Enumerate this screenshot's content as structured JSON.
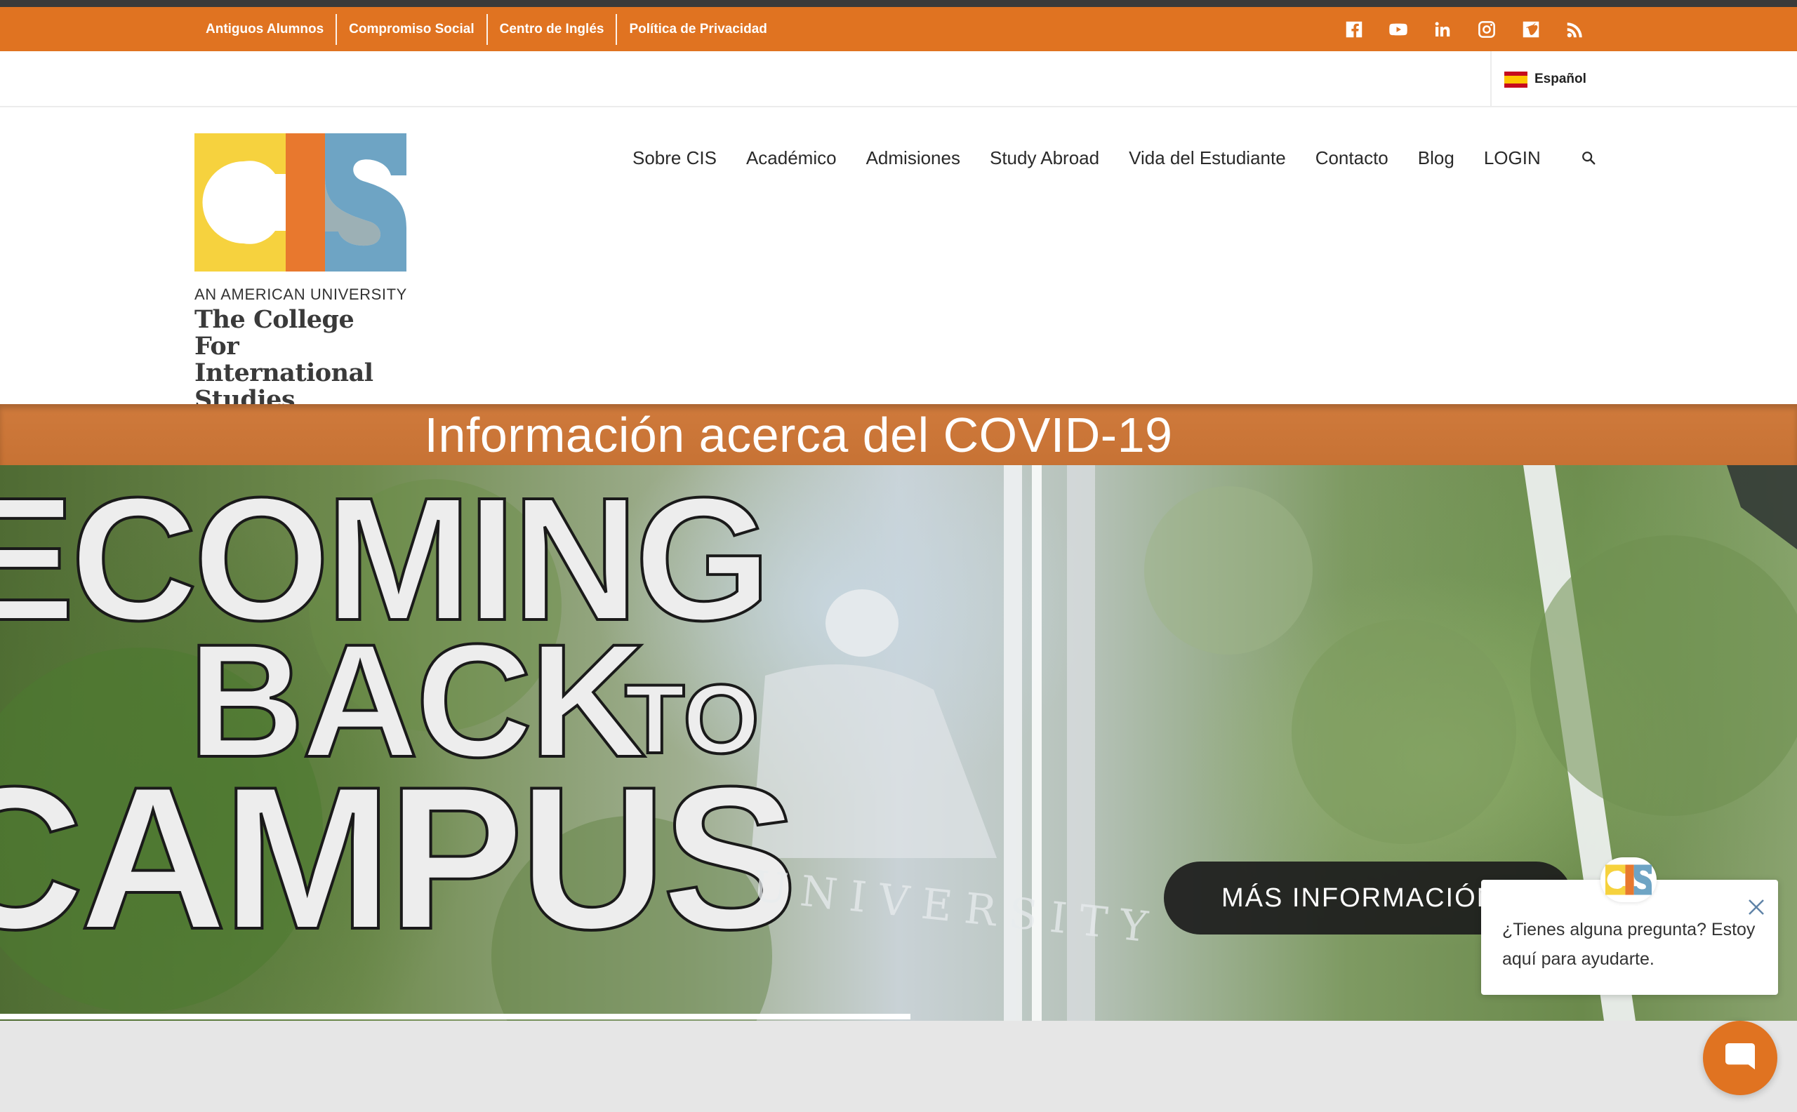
{
  "top_bar": {
    "links": [
      "Antiguos Alumnos",
      "Compromiso Social",
      "Centro de Inglés",
      "Política de Privacidad"
    ],
    "social": [
      "facebook-icon",
      "youtube-icon",
      "linkedin-icon",
      "instagram-icon",
      "vimeo-icon",
      "rss-icon"
    ]
  },
  "language": {
    "label": "Español"
  },
  "logo": {
    "subtitle": "AN AMERICAN UNIVERSITY",
    "name_line1": "The College",
    "name_line2": "For International",
    "name_line3": "Studies"
  },
  "nav": {
    "items": [
      "Sobre CIS",
      "Académico",
      "Admisiones",
      "Study Abroad",
      "Vida del Estudiante",
      "Contacto",
      "Blog",
      "LOGIN"
    ]
  },
  "banner": {
    "text": "Información acerca del COVID-19"
  },
  "hero": {
    "line1": "ECOMING",
    "line2": "BACK",
    "line2_small": "TO",
    "line3": "CAMPUS",
    "button": "MÁS INFORMACIÓN"
  },
  "chat": {
    "message": "¿Tienes alguna pregunta? Estoy aquí para ayudarte."
  },
  "colors": {
    "brand_orange": "#e07321",
    "logo_yellow": "#f6d23e",
    "logo_orange": "#e8782e",
    "logo_blue": "#6ea4c4"
  }
}
